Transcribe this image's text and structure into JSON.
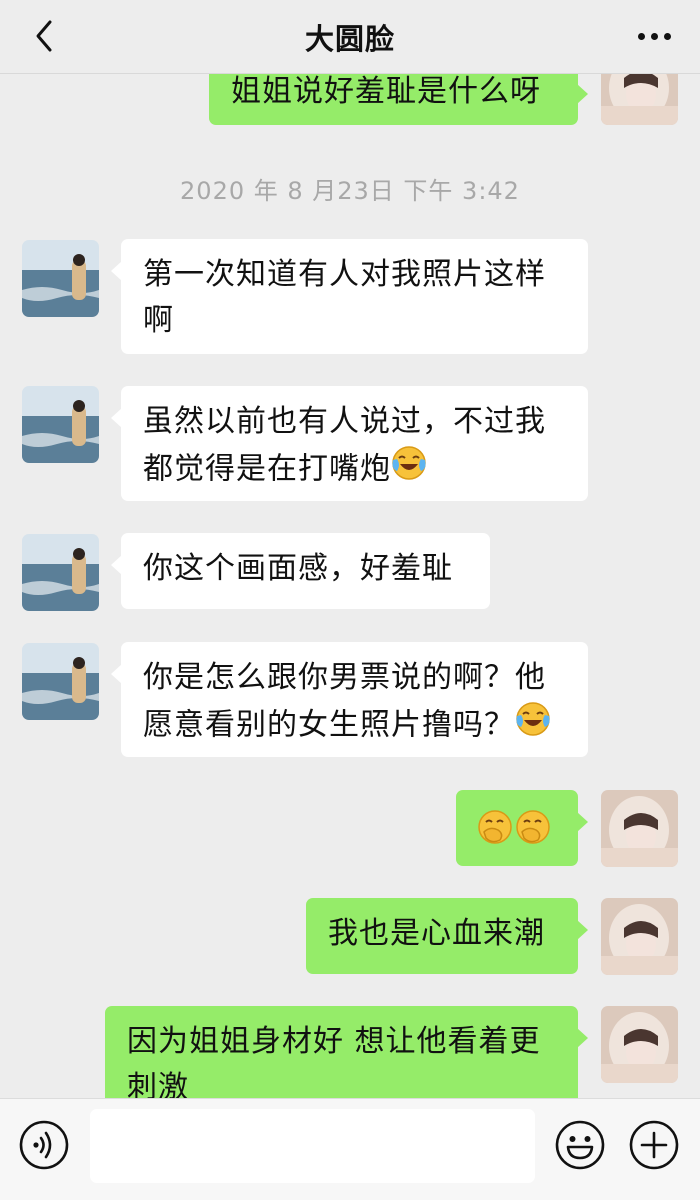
{
  "header": {
    "title": "大圆脸"
  },
  "timestamp": "2020 年 8 月23日 下午 3:42",
  "messages": {
    "m0": {
      "text": "姐姐说好羞耻是什么呀"
    },
    "m1": {
      "line1": "第一次知道有人对我照片这样",
      "line2": "啊"
    },
    "m2": {
      "line1": "虽然以前也有人说过，不过我",
      "line2": "都觉得是在打嘴炮"
    },
    "m3": {
      "text": "你这个画面感，好羞耻"
    },
    "m4": {
      "line1": "你是怎么跟你男票说的啊？他",
      "line2": "愿意看别的女生照片撸吗？"
    },
    "m6": {
      "text": "我也是心血来潮"
    },
    "m7": {
      "line1": "因为姐姐身材好 想让他看着更",
      "line2": "刺激"
    }
  },
  "input": {
    "value": ""
  },
  "colors": {
    "background": "#ededed",
    "incoming_bubble": "#ffffff",
    "outgoing_bubble": "#95ec69"
  },
  "icons": {
    "back": "chevron-left-icon",
    "more": "more-dots-icon",
    "voice": "voice-icon",
    "emoji": "emoji-icon",
    "plus": "plus-icon",
    "laugh_cry": "laugh-cry-emoji",
    "shush": "hand-over-mouth-emoji"
  }
}
